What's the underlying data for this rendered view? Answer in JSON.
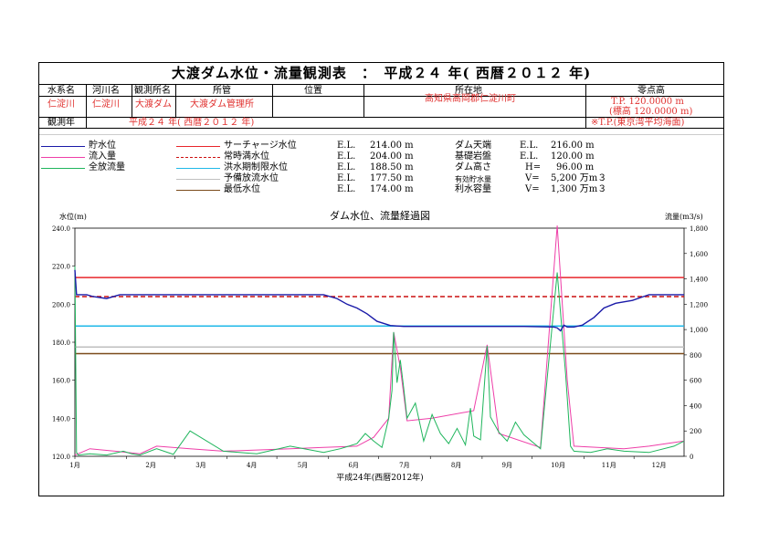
{
  "title": "大渡ダム水位・流量観測表　：　平成２４ 年( 西暦２０１２ 年)",
  "info": {
    "h_system": "水系名",
    "h_river": "河川名",
    "h_station": "観測所名",
    "h_office": "所管",
    "h_position": "位置",
    "h_location": "所在地",
    "h_datum": "零点高",
    "v_system": "仁淀川",
    "v_river": "仁淀川",
    "v_station": "大渡ダム",
    "v_office": "大渡ダム管理所",
    "v_location": "高知県高岡郡仁淀川町",
    "v_datum1": "T.P. 120.0000 m",
    "v_datum2": "(標高 120.0000 m)",
    "h_year": "観測年",
    "v_year": "平成２４ 年( 西暦２０１２ 年)",
    "v_tp": "※T.P.(東京湾平均海面)"
  },
  "legend": {
    "dam_level": "貯水位",
    "inflow": "流入量",
    "outflow": "全放流量",
    "surcharge": "サーチャージ水位",
    "normal": "常時満水位",
    "flood": "洪水期制限水位",
    "spillway": "予備放流水位",
    "lowest": "最低水位",
    "el": "E.L.",
    "v_surcharge": "214.00 m",
    "v_normal": "204.00 m",
    "v_flood": "188.50 m",
    "v_spillway": "177.50 m",
    "v_lowest": "174.00 m",
    "k_crest": "ダム天端",
    "k_base": "基礎岩盤",
    "k_height": "ダム高さ",
    "k_eff": "有効貯水量",
    "k_util": "利水容量",
    "p_crest": "E.L.",
    "p_base": "E.L.",
    "p_height": "H=",
    "p_eff": "V=",
    "p_util": "V=",
    "v_crest": "216.00 m",
    "v_base": "120.00 m",
    "v_height": "96.00 m",
    "v_eff": "5,200 万m３",
    "v_util": "1,300 万m３"
  },
  "colors": {
    "dam_level": "#1a1aa8",
    "inflow": "#ee3ea8",
    "outflow": "#1fb55c",
    "surcharge": "#e8262b",
    "normal": "#cc1010",
    "flood": "#1fb8e8",
    "spillway": "#bfbfbf",
    "lowest": "#7a4a1a"
  },
  "chart_data": {
    "type": "line",
    "title": "ダム水位、流量経過図",
    "xlabel": "平成24年(西暦2012年)",
    "ylabel_left": "水位(m)",
    "ylabel_right": "流量(m3/s)",
    "ylim_left": [
      120,
      240
    ],
    "ylim_right": [
      0,
      1800
    ],
    "yticks_left": [
      "120.0",
      "140.0",
      "160.0",
      "180.0",
      "200.0",
      "220.0",
      "240.0"
    ],
    "yticks_right": [
      "0",
      "200",
      "400",
      "600",
      "800",
      "1,000",
      "1,200",
      "1,400",
      "1,600",
      "1,800"
    ],
    "x_months": [
      "1月",
      "2月",
      "3月",
      "4月",
      "5月",
      "6月",
      "7月",
      "8月",
      "9月",
      "10月",
      "11月",
      "12月"
    ],
    "ref_lines": [
      {
        "name": "サーチャージ水位",
        "y": 214.0,
        "color": "#e8262b",
        "dash": false
      },
      {
        "name": "常時満水位",
        "y": 204.0,
        "color": "#cc1010",
        "dash": true
      },
      {
        "name": "洪水期制限水位",
        "y": 188.5,
        "color": "#1fb8e8",
        "dash": false
      },
      {
        "name": "予備放流水位",
        "y": 177.5,
        "color": "#bfbfbf",
        "dash": false
      },
      {
        "name": "最低水位",
        "y": 174.0,
        "color": "#7a4a1a",
        "dash": false
      }
    ],
    "series": [
      {
        "name": "貯水位",
        "axis": "left",
        "color": "#1a1aa8",
        "x": [
          1,
          2,
          3,
          8,
          12,
          20,
          28,
          40,
          60,
          90,
          120,
          150,
          158,
          164,
          170,
          176,
          182,
          190,
          198,
          210,
          240,
          270,
          288,
          290,
          292,
          294,
          296,
          300,
          305,
          312,
          318,
          325,
          335,
          345,
          360,
          366
        ],
        "y": [
          218,
          205,
          205,
          205,
          204,
          203,
          205,
          205,
          205,
          205,
          205,
          205,
          203,
          200,
          198,
          195,
          191,
          188.8,
          188.3,
          188.3,
          188.3,
          188.3,
          188.0,
          187.6,
          186,
          189,
          188.0,
          188.0,
          189,
          193,
          198,
          200.5,
          202,
          205,
          205,
          205
        ]
      },
      {
        "name": "全放流量",
        "axis": "right",
        "color": "#1fb55c",
        "x": [
          1,
          2,
          3,
          10,
          20,
          30,
          35,
          40,
          50,
          60,
          70,
          90,
          110,
          130,
          150,
          160,
          170,
          175,
          180,
          185,
          189,
          191,
          192,
          194,
          196,
          198,
          200,
          205,
          210,
          215,
          220,
          225,
          230,
          235,
          238,
          240,
          244,
          248,
          250,
          255,
          260,
          265,
          270,
          280,
          290,
          295,
          298,
          300,
          310,
          320,
          330,
          345,
          360,
          366
        ],
        "y": [
          1500,
          30,
          10,
          20,
          10,
          40,
          20,
          10,
          60,
          15,
          200,
          40,
          20,
          80,
          30,
          60,
          100,
          180,
          120,
          70,
          300,
          520,
          980,
          580,
          760,
          540,
          300,
          420,
          120,
          330,
          180,
          100,
          220,
          90,
          380,
          160,
          130,
          870,
          310,
          190,
          120,
          270,
          170,
          60,
          1450,
          650,
          80,
          40,
          30,
          60,
          40,
          30,
          80,
          120
        ]
      },
      {
        "name": "流入量",
        "axis": "right",
        "color": "#ee3ea8",
        "x": [
          1,
          3,
          10,
          25,
          40,
          50,
          70,
          90,
          110,
          130,
          150,
          170,
          180,
          189,
          192,
          196,
          200,
          215,
          240,
          248,
          255,
          280,
          290,
          296,
          300,
          330,
          345,
          366
        ],
        "y": [
          10,
          20,
          60,
          40,
          20,
          80,
          60,
          40,
          50,
          60,
          70,
          80,
          150,
          300,
          980,
          700,
          280,
          300,
          360,
          880,
          180,
          70,
          1820,
          600,
          80,
          60,
          80,
          120
        ]
      }
    ]
  }
}
